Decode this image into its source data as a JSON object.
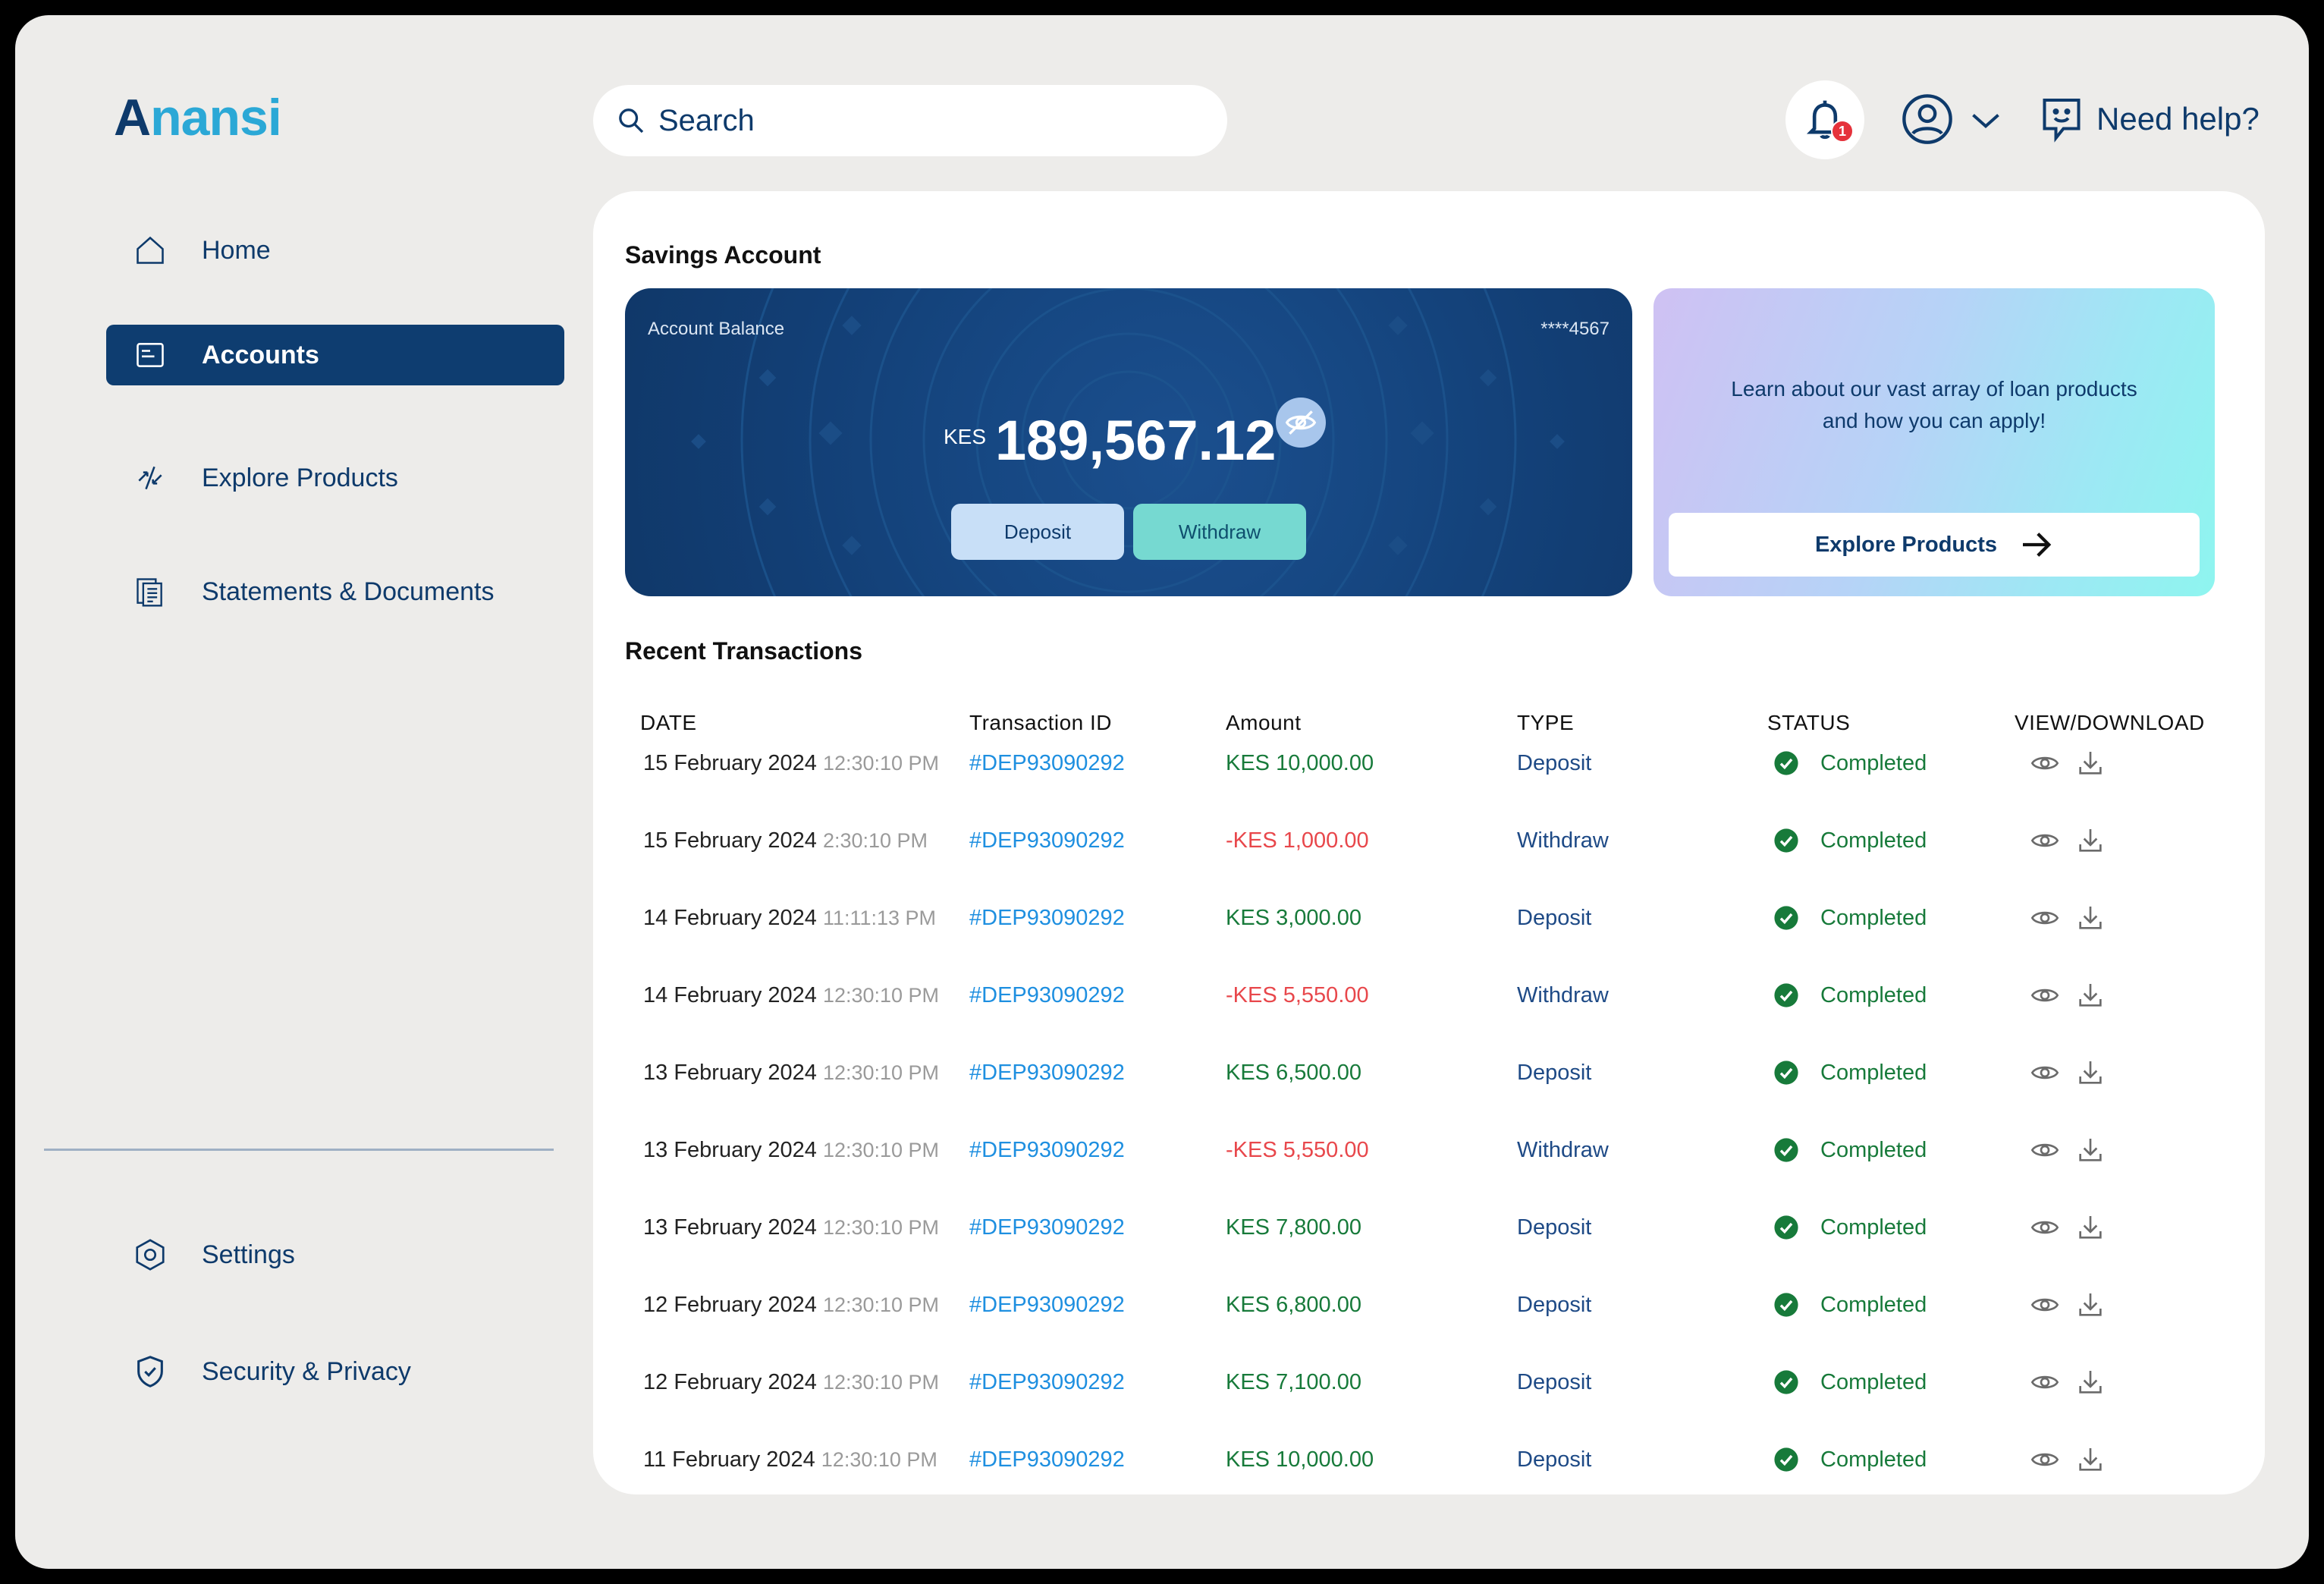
{
  "app": {
    "logo_first": "A",
    "logo_rest": "nansi"
  },
  "sidebar": {
    "items": [
      {
        "label": "Home",
        "icon": "home-icon"
      },
      {
        "label": "Accounts",
        "icon": "accounts-icon",
        "active": true
      },
      {
        "label": "Explore Products",
        "icon": "explore-icon"
      },
      {
        "label": "Statements & Documents",
        "icon": "documents-icon"
      }
    ],
    "bottom_items": [
      {
        "label": "Settings",
        "icon": "settings-icon"
      },
      {
        "label": "Security & Privacy",
        "icon": "shield-icon"
      }
    ]
  },
  "header": {
    "search_placeholder": "Search",
    "notification_count": "1",
    "help_label": "Need help?"
  },
  "savings": {
    "title": "Savings Account",
    "balance_label": "Account Balance",
    "account_masked": "****4567",
    "currency": "KES",
    "balance": "189,567.12",
    "deposit_label": "Deposit",
    "withdraw_label": "Withdraw"
  },
  "promo": {
    "text": "Learn about our vast array of loan products and how you can apply!",
    "button_label": "Explore Products"
  },
  "transactions": {
    "title": "Recent Transactions",
    "columns": [
      "DATE",
      "Transaction ID",
      "Amount",
      "TYPE",
      "STATUS",
      "VIEW/DOWNLOAD"
    ],
    "rows": [
      {
        "date": "15 February 2024",
        "time": "12:30:10 PM",
        "id": "#DEP93090292",
        "amount": "KES 10,000.00",
        "negative": false,
        "type": "Deposit",
        "status": "Completed"
      },
      {
        "date": "15 February 2024",
        "time": "2:30:10 PM",
        "id": "#DEP93090292",
        "amount": "-KES 1,000.00",
        "negative": true,
        "type": "Withdraw",
        "status": "Completed"
      },
      {
        "date": "14 February 2024",
        "time": "11:11:13 PM",
        "id": "#DEP93090292",
        "amount": "KES 3,000.00",
        "negative": false,
        "type": "Deposit",
        "status": "Completed"
      },
      {
        "date": "14 February 2024",
        "time": "12:30:10 PM",
        "id": "#DEP93090292",
        "amount": "-KES 5,550.00",
        "negative": true,
        "type": "Withdraw",
        "status": "Completed"
      },
      {
        "date": "13 February 2024",
        "time": "12:30:10 PM",
        "id": "#DEP93090292",
        "amount": "KES 6,500.00",
        "negative": false,
        "type": "Deposit",
        "status": "Completed"
      },
      {
        "date": "13 February 2024",
        "time": "12:30:10 PM",
        "id": "#DEP93090292",
        "amount": "-KES 5,550.00",
        "negative": true,
        "type": "Withdraw",
        "status": "Completed"
      },
      {
        "date": "13 February 2024",
        "time": "12:30:10 PM",
        "id": "#DEP93090292",
        "amount": "KES 7,800.00",
        "negative": false,
        "type": "Deposit",
        "status": "Completed"
      },
      {
        "date": "12 February 2024",
        "time": "12:30:10 PM",
        "id": "#DEP93090292",
        "amount": "KES 6,800.00",
        "negative": false,
        "type": "Deposit",
        "status": "Completed"
      },
      {
        "date": "12 February 2024",
        "time": "12:30:10 PM",
        "id": "#DEP93090292",
        "amount": "KES 7,100.00",
        "negative": false,
        "type": "Deposit",
        "status": "Completed"
      },
      {
        "date": "11 February 2024",
        "time": "12:30:10 PM",
        "id": "#DEP93090292",
        "amount": "KES 10,000.00",
        "negative": false,
        "type": "Deposit",
        "status": "Completed"
      }
    ]
  },
  "colors": {
    "brand_navy": "#0e3a6b",
    "brand_cyan": "#2ba8d6",
    "positive": "#177a3a",
    "negative": "#e8474b",
    "link": "#1e8fe0",
    "background": "#edecea"
  }
}
